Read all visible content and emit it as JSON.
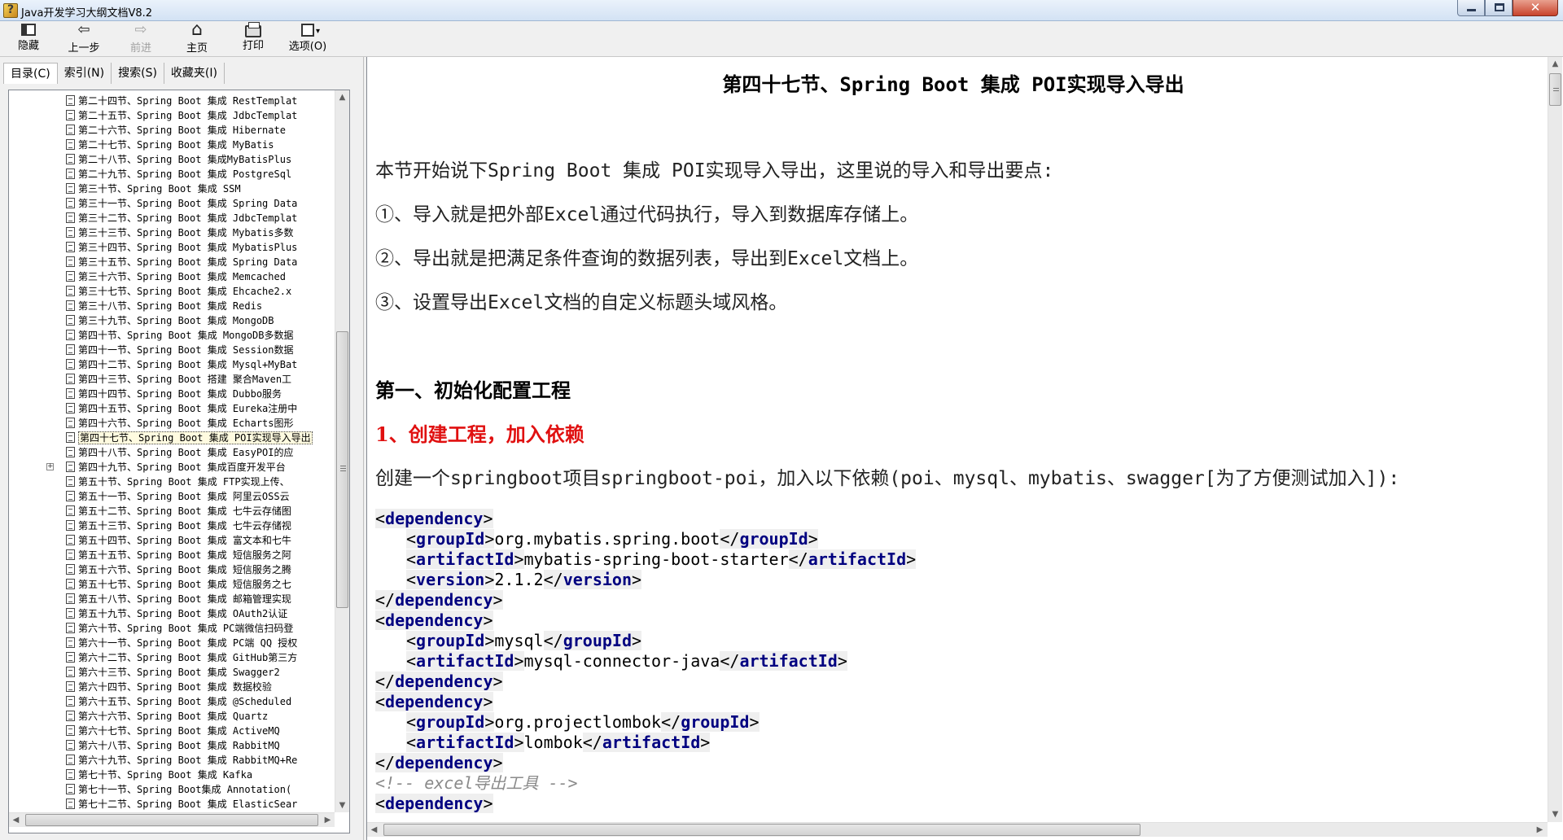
{
  "window": {
    "title": "Java开发学习大纲文档V8.2",
    "close_glyph": "✕"
  },
  "toolbar": {
    "hide": "隐藏",
    "back": "上一步",
    "forward": "前进",
    "home": "主页",
    "print": "打印",
    "options": "选项(O)"
  },
  "tabs": [
    "目录(C)",
    "索引(N)",
    "搜索(S)",
    "收藏夹(I)"
  ],
  "tree": {
    "items": [
      "第二十四节、Spring Boot 集成 RestTemplat",
      "第二十五节、Spring Boot 集成 JdbcTemplat",
      "第二十六节、Spring Boot 集成 Hibernate",
      "第二十七节、Spring Boot 集成 MyBatis",
      "第二十八节、Spring Boot 集成MyBatisPlus",
      "第二十九节、Spring Boot 集成 PostgreSql",
      "第三十节、Spring Boot 集成 SSM",
      "第三十一节、Spring Boot 集成 Spring Data",
      "第三十二节、Spring Boot 集成 JdbcTemplat",
      "第三十三节、Spring Boot 集成 Mybatis多数",
      "第三十四节、Spring Boot 集成 MybatisPlus",
      "第三十五节、Spring Boot 集成 Spring Data",
      "第三十六节、Spring Boot 集成 Memcached",
      "第三十七节、Spring Boot 集成 Ehcache2.x",
      "第三十八节、Spring Boot 集成 Redis",
      "第三十九节、Spring Boot 集成 MongoDB",
      "第四十节、Spring Boot 集成 MongoDB多数据",
      "第四十一节、Spring Boot 集成 Session数据",
      "第四十二节、Spring Boot 集成 Mysql+MyBat",
      "第四十三节、Spring Boot 搭建 聚合Maven工",
      "第四十四节、Spring Boot 集成 Dubbo服务",
      "第四十五节、Spring Boot 集成 Eureka注册中",
      "第四十六节、Spring Boot 集成 Echarts图形",
      "第四十七节、Spring Boot 集成 POI实现导入导出",
      "第四十八节、Spring Boot 集成 EasyPOI的应",
      "第四十九节、Spring Boot 集成百度开发平台",
      "第五十节、Spring Boot 集成 FTP实现上传、",
      "第五十一节、Spring Boot 集成 阿里云OSS云",
      "第五十二节、Spring Boot 集成 七牛云存储图",
      "第五十三节、Spring Boot 集成 七牛云存储视",
      "第五十四节、Spring Boot 集成 富文本和七牛",
      "第五十五节、Spring Boot 集成 短信服务之阿",
      "第五十六节、Spring Boot 集成 短信服务之腾",
      "第五十七节、Spring Boot 集成 短信服务之七",
      "第五十八节、Spring Boot 集成 邮箱管理实现",
      "第五十九节、Spring Boot 集成 OAuth2认证",
      "第六十节、Spring Boot 集成 PC端微信扫码登",
      "第六十一节、Spring Boot 集成 PC端 QQ 授权",
      "第六十二节、Spring Boot 集成 GitHub第三方",
      "第六十三节、Spring Boot 集成 Swagger2",
      "第六十四节、Spring Boot 集成 数据校验",
      "第六十五节、Spring Boot 集成 @Scheduled",
      "第六十六节、Spring Boot 集成 Quartz",
      "第六十七节、Spring Boot 集成 ActiveMQ",
      "第六十八节、Spring Boot 集成 RabbitMQ",
      "第六十九节、Spring Boot 集成 RabbitMQ+Re",
      "第七十节、Spring Boot 集成 Kafka",
      "第七十一节、Spring Boot集成 Annotation(",
      "第七十二节、Spring Boot 集成 ElasticSear"
    ],
    "selected_index": 23,
    "expander_index": 25,
    "expander_glyph": "+"
  },
  "doc": {
    "title": "第四十七节、Spring Boot 集成 POI实现导入导出",
    "intro": "本节开始说下Spring Boot 集成 POI实现导入导出，这里说的导入和导出要点:",
    "points": [
      "①、导入就是把外部Excel通过代码执行，导入到数据库存储上。",
      "②、导出就是把满足条件查询的数据列表，导出到Excel文档上。",
      "③、设置导出Excel文档的自定义标题头域风格。"
    ],
    "section1": "第一、初始化配置工程",
    "sub1": "1、创建工程，加入依赖",
    "desc1": "创建一个springboot项目springboot-poi，加入以下依赖(poi、mysql、mybatis、swagger[为了方便测试加入]):",
    "code": [
      {
        "indent": false,
        "tag": "dependency",
        "close": false
      },
      {
        "indent": true,
        "tag": "groupId",
        "value": "org.mybatis.spring.boot"
      },
      {
        "indent": true,
        "tag": "artifactId",
        "value": "mybatis-spring-boot-starter"
      },
      {
        "indent": true,
        "tag": "version",
        "value": "2.1.2"
      },
      {
        "indent": false,
        "tag": "dependency",
        "close": true
      },
      {
        "indent": false,
        "tag": "dependency",
        "close": false
      },
      {
        "indent": true,
        "tag": "groupId",
        "value": "mysql"
      },
      {
        "indent": true,
        "tag": "artifactId",
        "value": "mysql-connector-java"
      },
      {
        "indent": false,
        "tag": "dependency",
        "close": true
      },
      {
        "indent": false,
        "tag": "dependency",
        "close": false
      },
      {
        "indent": true,
        "tag": "groupId",
        "value": "org.projectlombok"
      },
      {
        "indent": true,
        "tag": "artifactId",
        "value": "lombok"
      },
      {
        "indent": false,
        "tag": "dependency",
        "close": true
      },
      {
        "indent": false,
        "comment": "<!-- excel导出工具 -->"
      },
      {
        "indent": false,
        "tag": "dependency",
        "close": false
      }
    ]
  },
  "scrollbar": {
    "up": "▲",
    "down": "▼",
    "left": "◀",
    "right": "▶"
  }
}
